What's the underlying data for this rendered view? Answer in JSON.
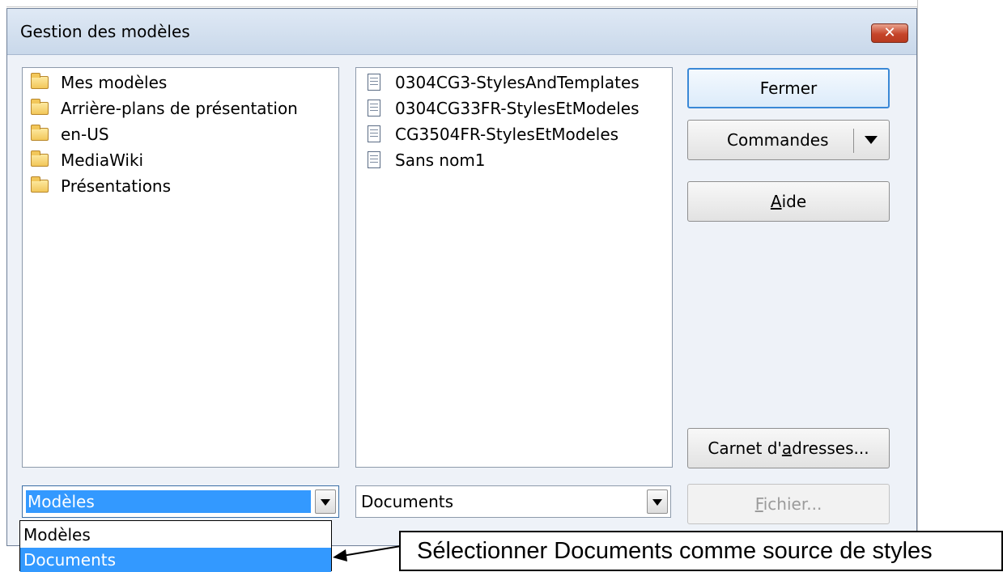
{
  "dialog": {
    "title": "Gestion des modèles",
    "close_glyph": "✕"
  },
  "left_list": {
    "items": [
      {
        "icon": "folder-icon",
        "label": "Mes modèles"
      },
      {
        "icon": "folder-icon",
        "label": "Arrière-plans de présentation"
      },
      {
        "icon": "folder-icon",
        "label": "en-US"
      },
      {
        "icon": "folder-icon",
        "label": "MediaWiki"
      },
      {
        "icon": "folder-icon",
        "label": "Présentations"
      }
    ]
  },
  "right_list": {
    "items": [
      {
        "icon": "document-icon",
        "label": "0304CG3-StylesAndTemplates"
      },
      {
        "icon": "document-icon",
        "label": "0304CG33FR-StylesEtModeles"
      },
      {
        "icon": "document-icon",
        "label": "CG3504FR-StylesEtModeles"
      },
      {
        "icon": "document-icon",
        "label": "Sans nom1"
      }
    ]
  },
  "buttons": {
    "fermer": "Fermer",
    "commandes": "Commandes",
    "aide_first": "A",
    "aide_rest": "ide",
    "carnet_pre": "Carnet d'",
    "carnet_u": "a",
    "carnet_post": "dresses...",
    "fichier_u": "F",
    "fichier_rest": "ichier..."
  },
  "left_combo": {
    "value": "Modèles",
    "options": [
      "Modèles",
      "Documents"
    ],
    "highlighted": "Documents"
  },
  "right_combo": {
    "value": "Documents"
  },
  "callout": {
    "text": "Sélectionner Documents comme source de styles"
  },
  "colors": {
    "selection": "#3399ff",
    "default_button_border": "#3a88d6",
    "close_button": "#c6452a"
  }
}
